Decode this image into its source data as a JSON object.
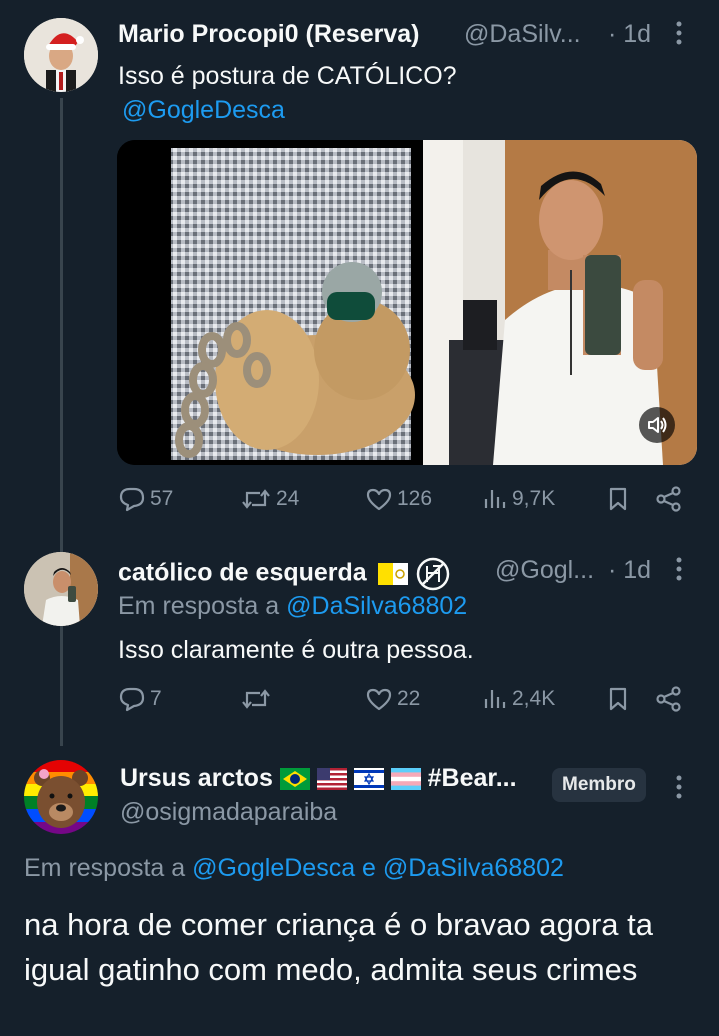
{
  "tweet1": {
    "name": "Mario Procopi0 (Reserva)",
    "handle": "@DaSilv...",
    "time": "· 1d",
    "text": "Isso é postura de CATÓLICO?",
    "mention": "@GogleDesca",
    "stats": {
      "replies": "57",
      "retweets": "24",
      "likes": "126",
      "views": "9,7K"
    }
  },
  "tweet2": {
    "name": "católico de esquerda",
    "handle": "@Gogl...",
    "time": "· 1d",
    "reply_prefix": "Em resposta a",
    "reply_to": "@DaSilva68802",
    "text": "Isso claramente é outra pessoa.",
    "stats": {
      "replies": "7",
      "retweets": "",
      "likes": "22",
      "views": "2,4K"
    }
  },
  "tweet3": {
    "name": "Ursus arctos",
    "name_suffix": "#Bear...",
    "badge": "Membro",
    "handle": "@osigmadaparaiba",
    "reply_prefix": "Em resposta a",
    "reply_to_1": "@GogleDesca",
    "reply_and": "e",
    "reply_to_2": "@DaSilva68802",
    "text": "na hora de comer criança é o bravao agora ta igual gatinho com medo, admita seus crimes"
  },
  "colors": {
    "background": "#15202b",
    "text": "#f7f9f9",
    "muted": "#8b98a5",
    "link": "#1d9bf0",
    "thread_line": "#38444d"
  },
  "icons": [
    "reply-icon",
    "retweet-icon",
    "like-icon",
    "views-icon",
    "bookmark-icon",
    "share-icon",
    "more-icon",
    "volume-icon"
  ]
}
